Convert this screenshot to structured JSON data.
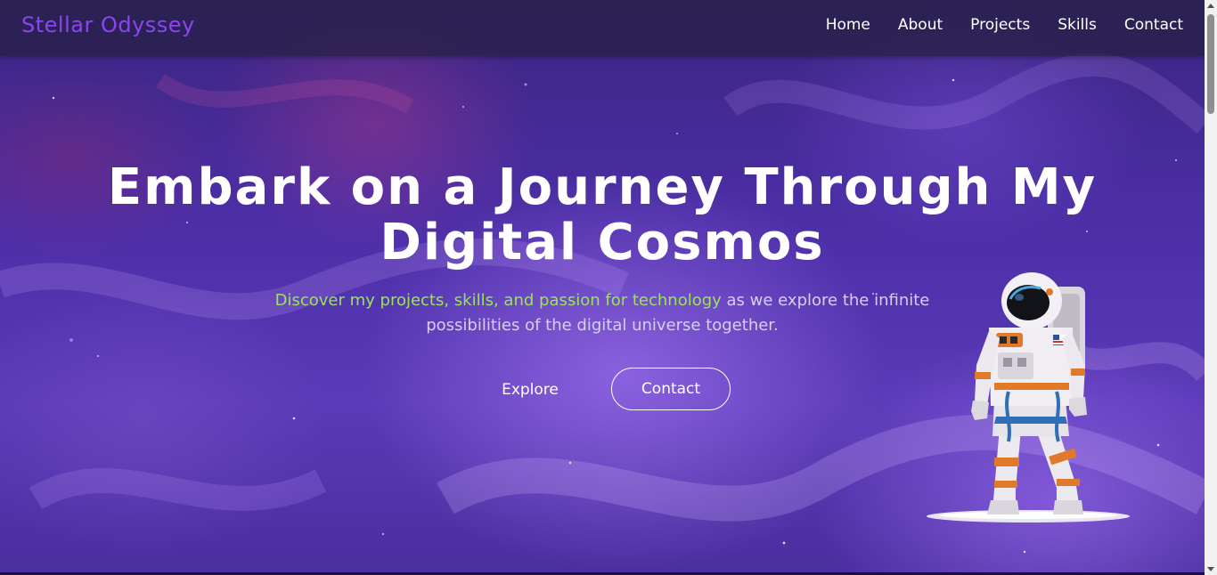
{
  "brand": {
    "name": "Stellar Odyssey",
    "color": "#8a45f0"
  },
  "nav": {
    "items": [
      {
        "label": "Home"
      },
      {
        "label": "About"
      },
      {
        "label": "Projects"
      },
      {
        "label": "Skills"
      },
      {
        "label": "Contact"
      }
    ]
  },
  "hero": {
    "title_line1": "Embark on a Journey Through My",
    "title_line2": "Digital Cosmos",
    "subtitle_highlight": "Discover my projects, skills, and passion for technology",
    "subtitle_rest": " as we explore the infinite possibilities of the digital universe together.",
    "highlight_color": "#9be35a",
    "explore_label": "Explore",
    "contact_label": "Contact"
  },
  "icons": {
    "hero_illustration": "astronaut-icon"
  }
}
